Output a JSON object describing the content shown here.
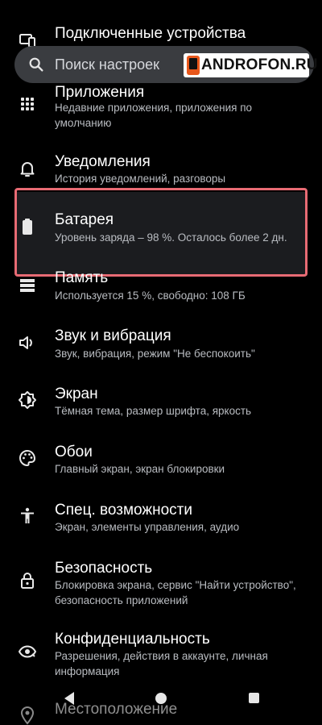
{
  "search": {
    "placeholder": "Поиск настроек"
  },
  "watermark": {
    "text": "ANDROFON.RU"
  },
  "settings": {
    "items": [
      {
        "icon": "devices-icon",
        "title": "Подключенные устройства",
        "subtitle": ""
      },
      {
        "icon": "apps-icon",
        "title": "Приложения",
        "subtitle": "Недавние приложения, приложения по умолчанию"
      },
      {
        "icon": "bell-icon",
        "title": "Уведомления",
        "subtitle": "История уведомлений, разговоры"
      },
      {
        "icon": "battery-icon",
        "title": "Батарея",
        "subtitle": "Уровень заряда – 98 %. Осталось более 2 дн."
      },
      {
        "icon": "storage-icon",
        "title": "Память",
        "subtitle": "Используется 15 %, свободно: 108 ГБ"
      },
      {
        "icon": "volume-icon",
        "title": "Звук и вибрация",
        "subtitle": "Звук, вибрация, режим \"Не беспокоить\""
      },
      {
        "icon": "display-icon",
        "title": "Экран",
        "subtitle": "Тёмная тема, размер шрифта, яркость"
      },
      {
        "icon": "palette-icon",
        "title": "Обои",
        "subtitle": "Главный экран, экран блокировки"
      },
      {
        "icon": "accessibility-icon",
        "title": "Спец. возможности",
        "subtitle": "Экран, элементы управления, аудио"
      },
      {
        "icon": "lock-icon",
        "title": "Безопасность",
        "subtitle": "Блокировка экрана, сервис \"Найти устройство\", безопасность приложений"
      },
      {
        "icon": "privacy-eye-icon",
        "title": "Конфиденциальность",
        "subtitle": "Разрешения, действия в аккаунте, личная информация"
      },
      {
        "icon": "location-icon",
        "title": "Местоположение",
        "subtitle": ""
      }
    ]
  },
  "highlight": {
    "item": "Батарея",
    "border_color": "#e86b74"
  },
  "nav": {
    "back": "back-icon",
    "home": "home-icon",
    "recents": "recents-icon"
  }
}
